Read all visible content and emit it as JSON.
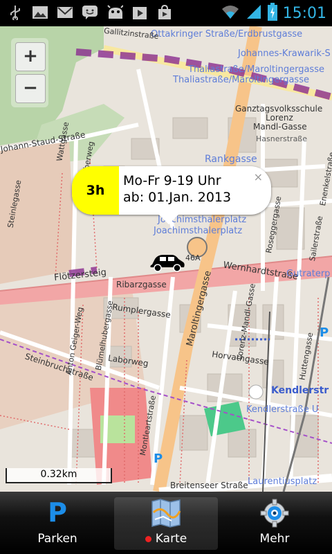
{
  "status_bar": {
    "time": "15:01",
    "notification_icons": [
      "usb-icon",
      "gallery-icon",
      "gmail-icon",
      "talk-icon",
      "android-icon",
      "play-icon",
      "play-store-icon"
    ],
    "status_icons": [
      "wifi-icon",
      "signal-icon",
      "battery-icon"
    ]
  },
  "map": {
    "zoom_in_label": "+",
    "zoom_out_label": "−",
    "streets": [
      "Ottakringer Straße/Erdbrustgasse",
      "Johannes-Krawarik-S",
      "Thaliastraße/Maroltingergasse",
      "Thaliastraße/Maroltingergasse",
      "Ganztagsvolksschule",
      "Lorenz",
      "Mandl-Gasse",
      "Hasnerstraße",
      "Rankgasse",
      "Joachimsthalerplatz",
      "Joachimsthalerplatz",
      "46A",
      "Flötzersteig",
      "Wernhardtstraße",
      "Ribarzgasse",
      "Rumplergasse",
      "Blümelhubergasse",
      "Anton Geiger-Weg",
      "Laborweg",
      "Steinbruchstraße",
      "Maroltingergasse",
      "Lorenz-Mandl-Gasse",
      "Horvathgasse",
      "Kendlerstr",
      "Kendlerstraße U",
      "Montleartstraße",
      "Breitenseer Straße",
      "Laurentiusplatz",
      "Johann-Staud-Straße",
      "Gutraterp",
      "Huttengasse",
      "Enenkelstraße",
      "Rosegger­gasse",
      "Wattgasse",
      "Weinheberweg",
      "Steinlegasse",
      "Sailerstraße",
      "Gallitzinstraße"
    ]
  },
  "popup": {
    "duration": "3h",
    "line1": "Mo-Fr 9-19 Uhr",
    "line2": "ab: 01.Jan. 2013",
    "close": "×"
  },
  "scale_label": "0.32km",
  "tabs": [
    {
      "label": "Parken",
      "icon": "parking-p-icon"
    },
    {
      "label": "Karte",
      "icon": "map-icon"
    },
    {
      "label": "Mehr",
      "icon": "gear-icon"
    }
  ],
  "colors": {
    "status_time": "#33b5e5",
    "badge": "#ffff00",
    "map_bg": "#ece7df",
    "major_road": "#f7c489",
    "primary_road": "#f4a8a8",
    "tram": "#8a2c8f",
    "parking_letter": "#1c8de8"
  }
}
